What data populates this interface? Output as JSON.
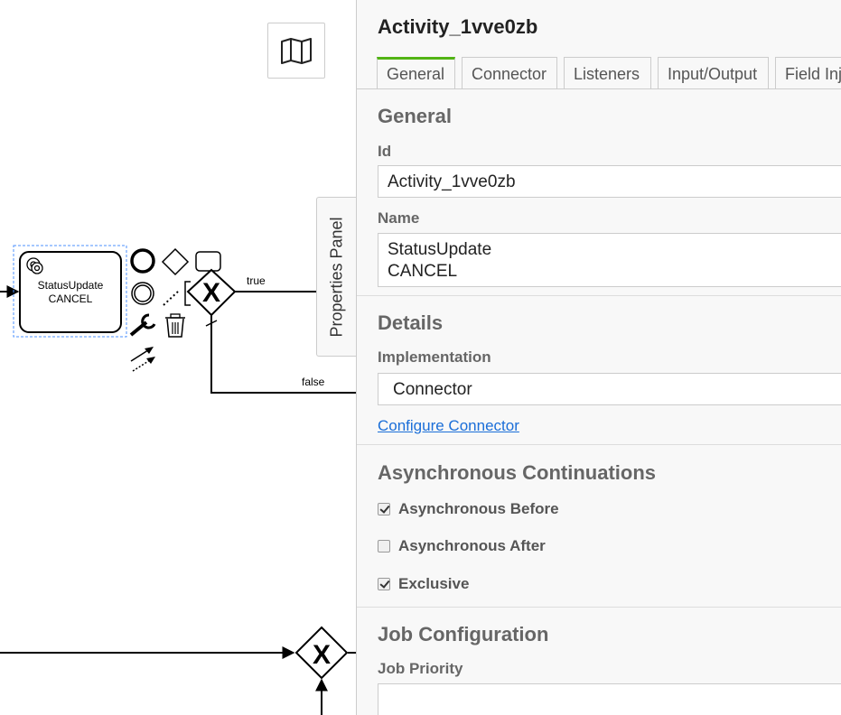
{
  "diagram": {
    "task_label_line1": "StatusUpdate",
    "task_label_line2": "CANCEL",
    "flow_true_label": "true",
    "flow_false_label": "false"
  },
  "toolbar": {
    "minimap_icon": "map-icon",
    "properties_panel_label": "Properties Panel"
  },
  "panel": {
    "title": "Activity_1vve0zb",
    "tabs": [
      {
        "label": "General",
        "active": true
      },
      {
        "label": "Connector",
        "active": false
      },
      {
        "label": "Listeners",
        "active": false
      },
      {
        "label": "Input/Output",
        "active": false
      },
      {
        "label": "Field Inj",
        "active": false
      }
    ],
    "general": {
      "title": "General",
      "id_label": "Id",
      "id_value": "Activity_1vve0zb",
      "name_label": "Name",
      "name_line1": "StatusUpdate",
      "name_line2": "CANCEL"
    },
    "details": {
      "title": "Details",
      "implementation_label": "Implementation",
      "implementation_value": "Connector",
      "configure_link": "Configure Connector"
    },
    "async": {
      "title": "Asynchronous Continuations",
      "before_label": "Asynchronous Before",
      "before_checked": true,
      "after_label": "Asynchronous After",
      "after_checked": false,
      "exclusive_label": "Exclusive",
      "exclusive_checked": true
    },
    "job": {
      "title": "Job Configuration",
      "priority_label": "Job Priority",
      "priority_value": ""
    }
  },
  "colors": {
    "accent": "#52b415",
    "link": "#1a6ed8",
    "selection": "#4d90fe"
  }
}
